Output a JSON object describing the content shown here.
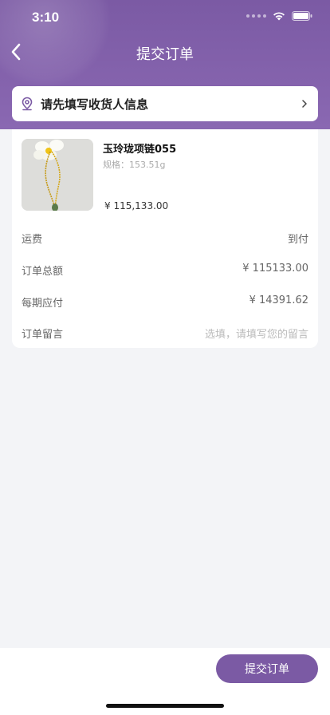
{
  "status_bar": {
    "time": "3:10"
  },
  "nav": {
    "title": "提交订单"
  },
  "address": {
    "prompt": "请先填写收货人信息"
  },
  "product": {
    "name": "玉玲珑项链055",
    "spec": "规格：153.51g",
    "price": "¥ 115,133.00"
  },
  "summary": {
    "rows": [
      {
        "label": "运费",
        "value": "到付"
      },
      {
        "label": "订单总额",
        "value": "¥ 115133.00"
      },
      {
        "label": "每期应付",
        "value": "¥ 14391.62"
      },
      {
        "label": "订单留言",
        "placeholder": "选填，请填写您的留言"
      }
    ]
  },
  "footer": {
    "submit_label": "提交订单"
  },
  "colors": {
    "brand": "#7b5aa4",
    "background": "#f3f4f7"
  }
}
